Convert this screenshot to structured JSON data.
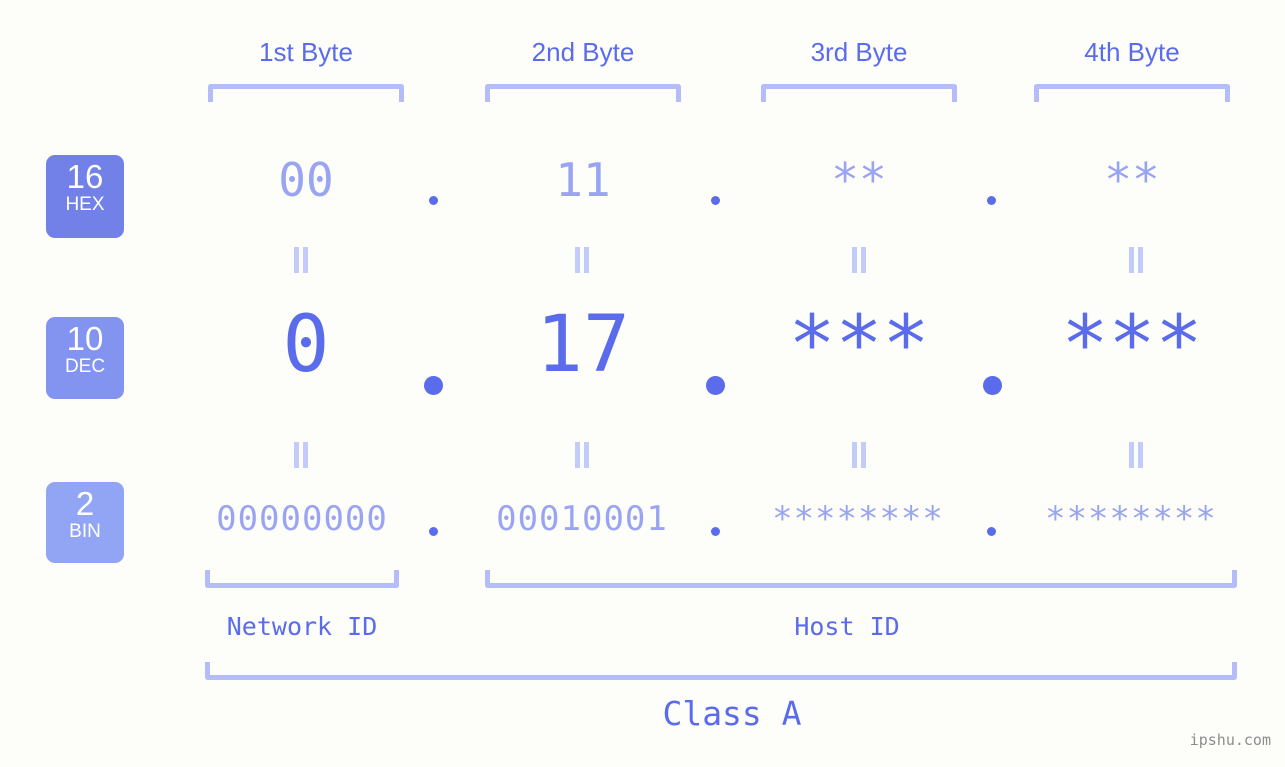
{
  "background_color": "#fdfdfa",
  "accent_color": "#5a6ceb",
  "muted_accent_color": "#99a5f2",
  "bracket_color": "#b4bdfa",
  "headers": [
    {
      "label": "1st Byte"
    },
    {
      "label": "2nd Byte"
    },
    {
      "label": "3rd Byte"
    },
    {
      "label": "4th Byte"
    }
  ],
  "bases": [
    {
      "number": "16",
      "name": "HEX",
      "color": "#7181e8"
    },
    {
      "number": "10",
      "name": "DEC",
      "color": "#8394f0"
    },
    {
      "number": "2",
      "name": "BIN",
      "color": "#92a5f4"
    }
  ],
  "rows": {
    "hex": {
      "values": [
        "00",
        "11",
        "**",
        "**"
      ],
      "separator": "."
    },
    "dec": {
      "values": [
        "0",
        "17",
        "***",
        "***"
      ],
      "separator": "."
    },
    "bin": {
      "values": [
        "00000000",
        "00010001",
        "********",
        "********"
      ],
      "separator": "."
    }
  },
  "equality_symbol": "=",
  "segments": [
    {
      "label": "Network ID"
    },
    {
      "label": "Host ID"
    }
  ],
  "class": {
    "label": "Class A"
  },
  "watermark": {
    "text": "ipshu.com"
  }
}
